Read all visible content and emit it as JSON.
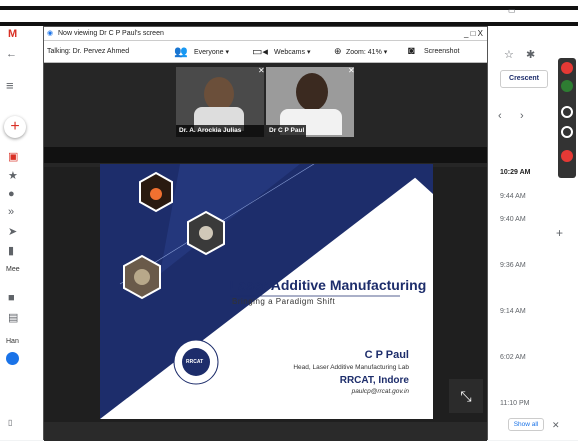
{
  "window": {
    "title": "Now viewing Dr C P Paul's screen",
    "title_controls": "_ □ X"
  },
  "toolbar": {
    "talking_label": "Talking: Dr. Pervez Ahmed",
    "everyone_label": "Everyone",
    "webcams_label": "Webcams",
    "zoom_label": "Zoom: 41%",
    "screenshot_label": "Screenshot"
  },
  "participants": [
    {
      "name": "Dr. A. Arockia Julias"
    },
    {
      "name": "Dr C P Paul"
    }
  ],
  "slide": {
    "title": "Laser Additive Manufacturing",
    "subtitle": "Bringing a Paradigm Shift",
    "presenter": "C P Paul",
    "role": "Head, Laser Additive Manufacturing Lab",
    "org": "RRCAT, Indore",
    "email": "paulcp@rrcat.gov.in",
    "logo_text": "RRCAT"
  },
  "gmail": {
    "left_labels": [
      "Mee",
      "Han"
    ],
    "times": [
      "10:29 AM",
      "9:44 AM",
      "9:40 AM",
      "9:36 AM",
      "9:14 AM",
      "6:02 AM",
      "11:10 PM"
    ],
    "show_all": "Show all",
    "crescent": "Crescent"
  },
  "colors": {
    "slide_navy": "#1d2d6b",
    "accent_red": "#e53935",
    "accent_green": "#2e7d32"
  }
}
